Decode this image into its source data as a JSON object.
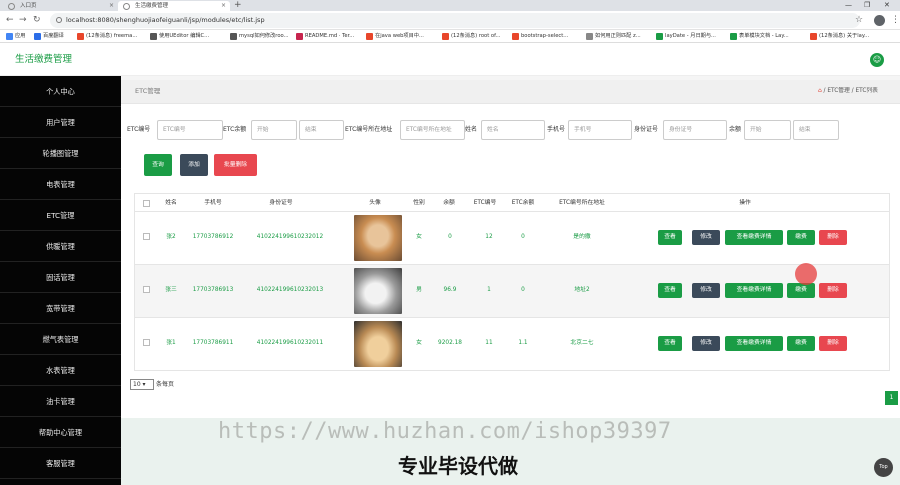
{
  "browser": {
    "tabs": [
      {
        "label": "入口页",
        "active": false
      },
      {
        "label": "生活缴费管理",
        "active": true
      }
    ],
    "new_tab_glyph": "+",
    "window_controls": [
      "—",
      "❐",
      "✕"
    ],
    "nav": {
      "back": "←",
      "forward": "→",
      "reload": "↻"
    },
    "url": "localhost:8080/shenghuojiaofeiguanli/jsp/modules/etc/list.jsp",
    "star_glyph": "☆",
    "menu_glyph": "⋮",
    "bookmarks": [
      {
        "label": "应用",
        "color": "#4285f4"
      },
      {
        "label": "百度翻译",
        "color": "#2b6de8"
      },
      {
        "label": "(12条消息) freema...",
        "color": "#e8462b"
      },
      {
        "label": "使用UEditor 编辑C...",
        "color": "#555555"
      },
      {
        "label": "mysql如何修改roo...",
        "color": "#555555"
      },
      {
        "label": "README.md · Ter...",
        "color": "#c7254e"
      },
      {
        "label": "在java web项目中...",
        "color": "#e8462b"
      },
      {
        "label": "(12条消息) root of...",
        "color": "#e8462b"
      },
      {
        "label": "bootstrap-select...",
        "color": "#e8462b"
      },
      {
        "label": "如何用正则匹配 z...",
        "color": "#888888"
      },
      {
        "label": "layDate - 月日期与...",
        "color": "#1a9c45"
      },
      {
        "label": "表单模块文档 - Lay...",
        "color": "#1a9c45"
      },
      {
        "label": "(12条消息) 关于lay...",
        "color": "#e8462b"
      }
    ]
  },
  "app": {
    "title": "生活缴费管理",
    "user_icon": "user-icon",
    "accent": "#1a9c45"
  },
  "sidebar": {
    "items": [
      {
        "label": "个人中心"
      },
      {
        "label": "用户管理"
      },
      {
        "label": "轮播图管理"
      },
      {
        "label": "电表管理"
      },
      {
        "label": "ETC管理"
      },
      {
        "label": "供暖管理"
      },
      {
        "label": "固话管理"
      },
      {
        "label": "宽带管理"
      },
      {
        "label": "燃气表管理"
      },
      {
        "label": "水表管理"
      },
      {
        "label": "油卡管理"
      },
      {
        "label": "帮助中心管理"
      },
      {
        "label": "客服管理"
      }
    ]
  },
  "breadcrumb": {
    "left": "ETC管理",
    "home_icon": "⌂",
    "right": " / ETC管理 / ETC列表"
  },
  "filters": [
    {
      "label": "ETC编号",
      "placeholder": "ETC编号"
    },
    {
      "label": "ETC余额",
      "placeholder": "开始"
    },
    {
      "label": "",
      "placeholder": "结束"
    },
    {
      "label": "ETC编号所在地址",
      "placeholder": "ETC编号所在地址"
    },
    {
      "label": "姓名",
      "placeholder": "姓名"
    },
    {
      "label": "手机号",
      "placeholder": "手机号"
    },
    {
      "label": "身份证号",
      "placeholder": "身份证号"
    },
    {
      "label": "余额",
      "placeholder": "开始"
    },
    {
      "label": "",
      "placeholder": "结束"
    }
  ],
  "toolbar": {
    "search_label": "查询",
    "add_label": "添加",
    "batch_delete_label": "批量删除"
  },
  "table": {
    "headers": [
      "姓名",
      "手机号",
      "身份证号",
      "头像",
      "性别",
      "余额",
      "ETC编号",
      "ETC余额",
      "ETC编号所在地址",
      "操作"
    ],
    "rows": [
      {
        "name": "张2",
        "phone": "17703786912",
        "id_card": "410224199610232012",
        "avatar": "shiba-dog-photo",
        "gender": "女",
        "balance": "0",
        "etc_no": "12",
        "etc_balance": "0",
        "address": "是的撒"
      },
      {
        "name": "张三",
        "phone": "17703786913",
        "id_card": "410224199610232013",
        "avatar": "husky-dog-photo",
        "gender": "男",
        "balance": "96.9",
        "etc_no": "1",
        "etc_balance": "0",
        "address": "地址2"
      },
      {
        "name": "张1",
        "phone": "17703786911",
        "id_card": "410224199610232011",
        "avatar": "cat-with-hat-photo",
        "gender": "女",
        "balance": "9202.18",
        "etc_no": "11",
        "etc_balance": "1.1",
        "address": "北京二七"
      }
    ],
    "actions": {
      "view": "查看",
      "edit": "修改",
      "view_payment": "查看缴费详情",
      "pay": "缴费",
      "delete": "删除"
    }
  },
  "pagination": {
    "page_size": "10",
    "page_size_label": "条每页",
    "current_page": "1"
  },
  "watermark": {
    "url": "https://www.huzhan.com/ishop39397",
    "slogan": "专业毕设代做"
  },
  "back_to_top": "Top"
}
